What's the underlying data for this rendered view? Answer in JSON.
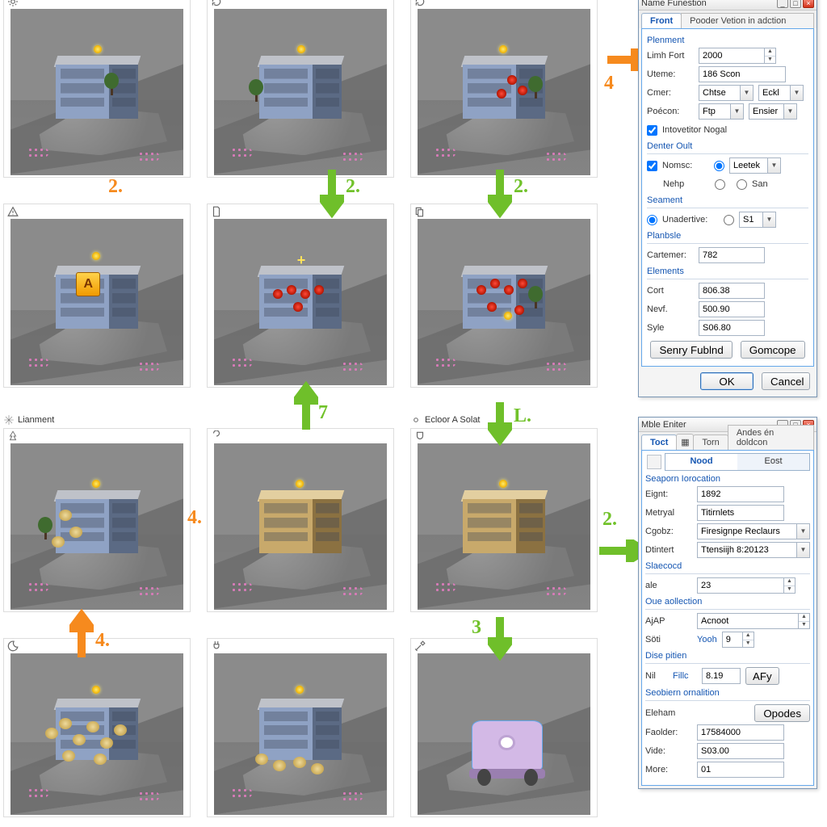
{
  "thumbs": {
    "r1": {
      "badge": ""
    },
    "r5": {
      "title": "Lianment"
    },
    "r9": {
      "title": "Ecloor A Solat"
    }
  },
  "steps": {
    "s2a": "2.",
    "s2b": "2.",
    "s2c": "2.",
    "s4a": "4",
    "s4b": "4.",
    "s4c": "4.",
    "s7": "7",
    "sL": "L.",
    "s3": "3",
    "s2r": "2."
  },
  "dialog1": {
    "title": "Name Funestion",
    "tabs": {
      "front": "Front",
      "second": "Pooder Vetion in adction"
    },
    "grp_placement": "Plenment",
    "limit_fort_label": "Limh Fort",
    "limit_fort_value": "2000",
    "uname_label": "Uteme:",
    "uname_value": "186 Scon",
    "cmer_label": "Cmer:",
    "cmer_btn1": "Chtse",
    "cmer_btn2": "Eckl",
    "pos_label": "Poécon:",
    "pos_btn1": "Ftp",
    "pos_btn2": "Ensier",
    "interactive_label": "Intovetitor Nogal",
    "grp_denter": "Denter Oult",
    "nomse_label": "Nomsc:",
    "nehp_label": "Nehp",
    "leetok_btn": "Leetek",
    "son_label": "San",
    "grp_seament": "Seament",
    "unadertive_label": "Unadertive:",
    "s1_value": "S1",
    "grp_planbsle": "Planbsle",
    "cartemer_label": "Cartemer:",
    "cartemer_value": "782",
    "grp_elements": "Elements",
    "cort_label": "Cort",
    "cort_value": "806.38",
    "newf_label": "Nevf.",
    "newf_value": "500.90",
    "syle_label": "Syle",
    "syle_value": "S06.80",
    "btn_senry": "Senry Fublnd",
    "btn_gam": "Gomcope",
    "ok": "OK",
    "cancel": "Cancel"
  },
  "dialog2": {
    "title": "Mble Eniter",
    "tabs": {
      "toct": "Toct",
      "mid": "",
      "torn": "Torn",
      "andes": "Andes én doldcon"
    },
    "sub": {
      "nood": "Nood",
      "eost": "Eost"
    },
    "grp_seaporn": "Seaporn Iorocation",
    "eignt_label": "Eignt:",
    "eignt_value": "1892",
    "metryal_label": "Metryal",
    "metryal_value": "Titirnlets",
    "cgobs_label": "Cgobz:",
    "cgobs_value": "Firesignpe Reclaurs",
    "dtintert_label": "Dtintert",
    "dtintert_value": "Ttensiijh 8:20123",
    "grp_slaecod": "Slaecocd",
    "ale_label": "ale",
    "ale_value": "23",
    "grp_oue": "Oue aollection",
    "ajap_label": "AjAP",
    "ajap_value": "Acnoot",
    "soti_label": "Söti",
    "soti_yooh": "Yooh",
    "soti_value": "9",
    "grp_dise": "Dise pitien",
    "nil_label": "Nil",
    "fillc_label": "Fillc",
    "fillc_value": "8.19",
    "afy_btn": "AFy",
    "grp_seobiern": "Seobiern ornalition",
    "eleham_label": "Eleham",
    "opodes_btn": "Opodes",
    "faolder_label": "Faolder:",
    "faolder_value": "17584000",
    "vide_label": "Vide:",
    "vide_value": "S03.00",
    "more_label": "More:",
    "more_value": "01"
  }
}
